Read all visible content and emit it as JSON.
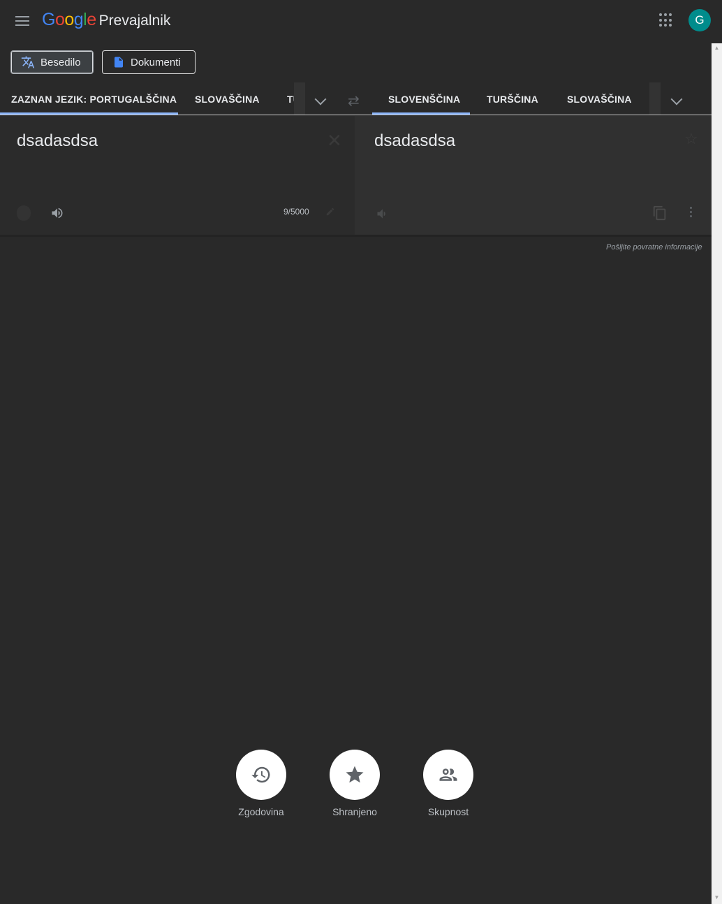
{
  "header": {
    "logo_letters": [
      "G",
      "o",
      "o",
      "g",
      "l",
      "e"
    ],
    "product": "Prevajalnik",
    "avatar_letter": "G"
  },
  "modes": [
    {
      "label": "Besedilo",
      "active": true
    },
    {
      "label": "Dokumenti",
      "active": false
    }
  ],
  "source_langs": [
    "ZAZNAN JEZIK: PORTUGALŠČINA",
    "SLOVAŠČINA",
    "TUI"
  ],
  "target_langs": [
    "SLOVENŠČINA",
    "TURŠČINA",
    "SLOVAŠČINA"
  ],
  "source": {
    "text": "dsadasdsa",
    "counter": "9/5000"
  },
  "target": {
    "text": "dsadasdsa"
  },
  "feedback": "Pošljite povratne informacije",
  "bottom": [
    {
      "label": "Zgodovina",
      "icon": "history-icon"
    },
    {
      "label": "Shranjeno",
      "icon": "star-icon"
    },
    {
      "label": "Skupnost",
      "icon": "community-icon"
    }
  ],
  "colors": {
    "accent": "#8ab4f8",
    "background": "#292929",
    "avatar": "#008c8c"
  }
}
